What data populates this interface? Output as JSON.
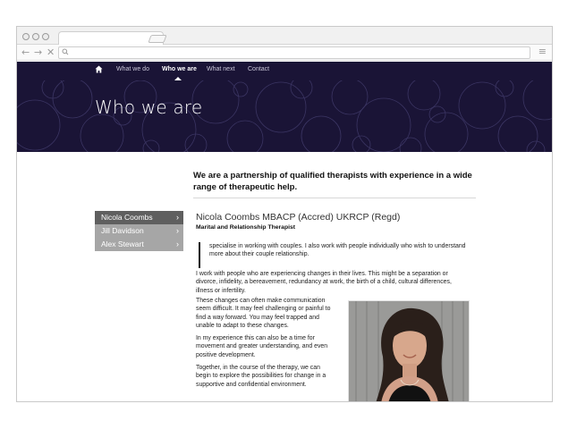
{
  "browser": {
    "tab_close": "×",
    "nav_back": "←",
    "nav_forward": "→",
    "nav_stop": "✕",
    "menu": "≡"
  },
  "site_nav": {
    "items": [
      "What we do",
      "Who we are",
      "What next",
      "Contact"
    ],
    "active": "Who we are"
  },
  "hero": {
    "title": "Who we are"
  },
  "intro": "We are a partnership of qualified therapists with experience in a wide range of therapeutic help.",
  "sidebar": {
    "items": [
      {
        "label": "Nicola Coombs"
      },
      {
        "label": "Jill Davidson"
      },
      {
        "label": "Alex Stewart"
      }
    ]
  },
  "profile": {
    "name": "Nicola Coombs MBACP (Accred) UKRCP (Regd)",
    "role": "Marital and Relationship Therapist",
    "p1": "specialise in working with couples. I also work with people individually who wish to understand more about their couple relationship.",
    "p2": "I work with people who are experiencing changes in their lives. This might be a separation or divorce, infidelity, a bereavement, redundancy at work, the birth of a child, cultural differences, illness or infertility.",
    "p3": "These changes can often make communication seem difficult. It may feel challenging or painful to find a way forward. You may feel trapped and unable to adapt to these changes.",
    "p4": "In my experience this can also be a time for movement and greater understanding, and even positive development.",
    "p5": "Together, in the course of the therapy, we can begin to explore the possibilities for change in a supportive and confidential environment."
  },
  "colors": {
    "nav_bg": "#1a1436",
    "sidebar_active": "#5f5f5f",
    "sidebar_inactive": "#a6a6a6"
  }
}
